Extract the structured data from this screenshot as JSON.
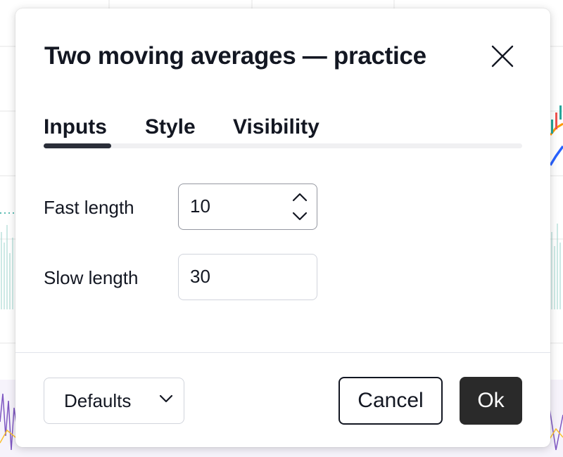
{
  "dialog": {
    "title": "Two moving averages — practice",
    "close_icon": "close-icon"
  },
  "tabs": [
    {
      "label": "Inputs",
      "active": true
    },
    {
      "label": "Style",
      "active": false
    },
    {
      "label": "Visibility",
      "active": false
    }
  ],
  "inputs": {
    "fast_length": {
      "label": "Fast length",
      "value": "10"
    },
    "slow_length": {
      "label": "Slow length",
      "value": "30"
    }
  },
  "footer": {
    "defaults_label": "Defaults",
    "cancel_label": "Cancel",
    "ok_label": "Ok"
  },
  "colors": {
    "accent_dark": "#2a2a2a",
    "fast_ma": "#ff9800",
    "slow_ma": "#2962ff",
    "oscillator": "#7e57c2",
    "oscillator_signal": "#fbc02d",
    "candle_up": "#26a69a",
    "candle_down": "#ef5350"
  }
}
